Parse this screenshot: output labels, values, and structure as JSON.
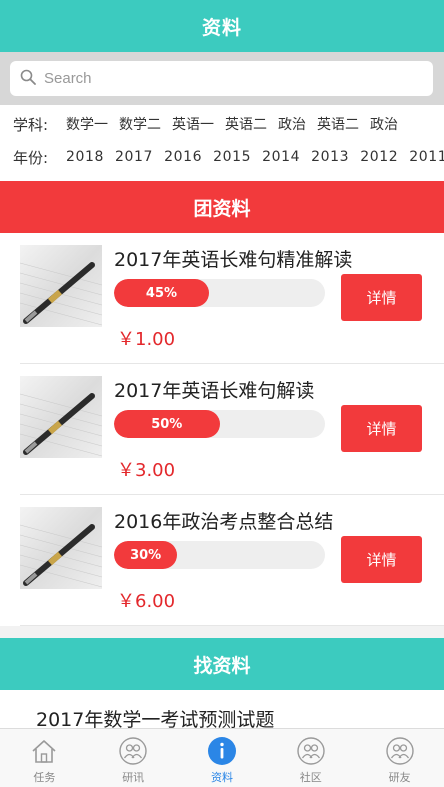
{
  "header": {
    "title": "资料"
  },
  "search": {
    "placeholder": "Search",
    "value": ""
  },
  "filters": {
    "subject_label": "学科:",
    "subjects": [
      "数学一",
      "数学二",
      "英语一",
      "英语二",
      "政治",
      "英语二",
      "政治"
    ],
    "year_label": "年份:",
    "years": [
      "2018",
      "2017",
      "2016",
      "2015",
      "2014",
      "2013",
      "2012",
      "2011"
    ]
  },
  "group_section": {
    "title": "团资料"
  },
  "materials": [
    {
      "title": "2017年英语长难句精准解读",
      "progress_label": "45%",
      "progress": 0.45,
      "price": "￥1.00",
      "detail_label": "详情"
    },
    {
      "title": "2017年英语长难句解读",
      "progress_label": "50%",
      "progress": 0.5,
      "price": "￥3.00",
      "detail_label": "详情"
    },
    {
      "title": "2016年政治考点整合总结",
      "progress_label": "30%",
      "progress": 0.3,
      "price": "￥6.00",
      "detail_label": "详情"
    }
  ],
  "find_section": {
    "title": "找资料"
  },
  "find_list": [
    {
      "title": "2017年数学一考试预测试题"
    }
  ],
  "tabbar": [
    {
      "label": "任务",
      "icon": "home-icon",
      "active": false
    },
    {
      "label": "研讯",
      "icon": "people-icon",
      "active": false
    },
    {
      "label": "资料",
      "icon": "info-icon",
      "active": true
    },
    {
      "label": "社区",
      "icon": "people-icon",
      "active": false
    },
    {
      "label": "研友",
      "icon": "people-icon",
      "active": false
    }
  ],
  "colors": {
    "teal": "#3ccbbf",
    "red": "#f23a3c",
    "price_red": "#e3282c",
    "active_blue": "#2b86e6"
  }
}
